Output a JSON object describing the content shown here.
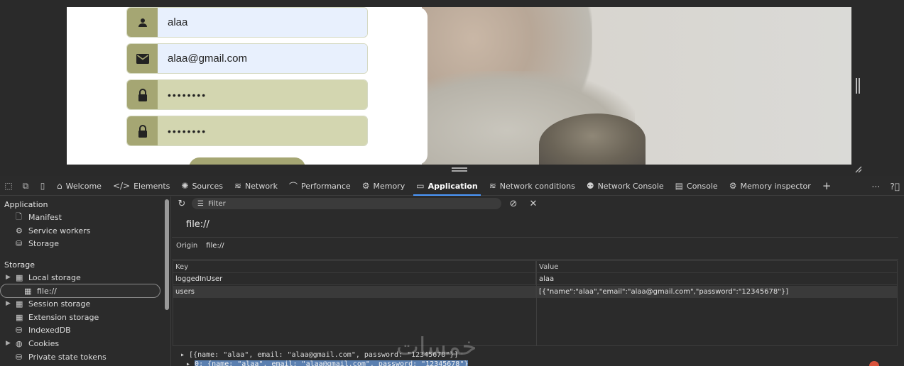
{
  "form": {
    "username": "alaa",
    "email": "alaa@gmail.com",
    "password": "••••••••",
    "confirm_password": "••••••••"
  },
  "icons": {
    "user": "user-icon",
    "email": "envelope-icon",
    "lock": "lock-icon"
  },
  "colors": {
    "olive_accent": "#a5a673",
    "olive_field": "#d3d6b0",
    "autofill_field": "#e8f0fd",
    "devtools_bg": "#2b2b2b",
    "active_tab_underline": "#4c9aff"
  },
  "devtools": {
    "tabs": [
      {
        "label": "Welcome",
        "glyph": "⌂"
      },
      {
        "label": "Elements",
        "glyph": "</>"
      },
      {
        "label": "Sources",
        "glyph": "✺"
      },
      {
        "label": "Network",
        "glyph": "≋"
      },
      {
        "label": "Performance",
        "glyph": "⌒"
      },
      {
        "label": "Memory",
        "glyph": "⚙"
      },
      {
        "label": "Application",
        "glyph": "▭"
      },
      {
        "label": "Network conditions",
        "glyph": "≋"
      },
      {
        "label": "Network Console",
        "glyph": "⚉"
      },
      {
        "label": "Console",
        "glyph": "▤"
      },
      {
        "label": "Memory inspector",
        "glyph": "⚙"
      }
    ],
    "active_tab": "Application",
    "sidebar": {
      "application_heading": "Application",
      "manifest": "Manifest",
      "service_workers": "Service workers",
      "storage": "Storage",
      "storage_heading": "Storage",
      "local_storage": "Local storage",
      "local_file": "file://",
      "session_storage": "Session storage",
      "extension_storage": "Extension storage",
      "indexeddb": "IndexedDB",
      "cookies": "Cookies",
      "private_state_tokens": "Private state tokens"
    },
    "filter_placeholder": "Filter",
    "origin_title": "file://",
    "origin_label": "Origin",
    "origin_value": "file://",
    "table": {
      "key_header": "Key",
      "value_header": "Value",
      "rows": [
        {
          "key": "loggedInUser",
          "value": "alaa"
        },
        {
          "key": "users",
          "value": "[{\"name\":\"alaa\",\"email\":\"alaa@gmail.com\",\"password\":\"12345678\"}]"
        }
      ]
    },
    "preview_line1": "▸ [{name: \"alaa\", email: \"alaa@gmail.com\", password: \"12345678\"}]",
    "preview_line2_prefix": "▸ ",
    "preview_line2_highlight": "0: {name: \"alaa\", email: \"alaa@gmail.com\", password: \"12345678\"}"
  },
  "watermark": "خمسات"
}
